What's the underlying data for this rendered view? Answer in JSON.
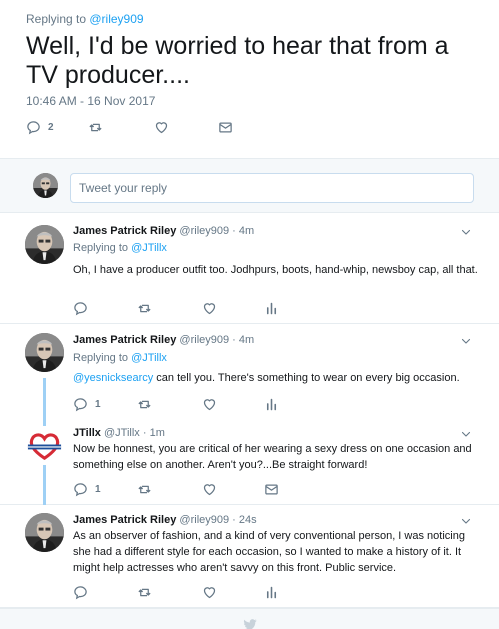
{
  "main_tweet": {
    "replying_prefix": "Replying to ",
    "replying_handle": "@riley909",
    "text": "Well, I'd be worried to hear that from a TV producer....",
    "timestamp": "10:46 AM - 16 Nov 2017",
    "reply_count": "2"
  },
  "reply_box": {
    "placeholder": "Tweet your reply"
  },
  "tweets": [
    {
      "name": "James Patrick Riley",
      "handle": "@riley909",
      "sep": " · ",
      "time": "4m",
      "replying_prefix": "Replying to ",
      "replying_handle": "@JTillx",
      "text": "Oh, I have a producer outfit too.  Jodhpurs, boots, hand-whip, newsboy cap, all that."
    },
    {
      "name": "James Patrick Riley",
      "handle": "@riley909",
      "sep": " · ",
      "time": "4m",
      "replying_prefix": "Replying to ",
      "replying_handle": "@JTillx",
      "mention": "@yesnicksearcy",
      "text": " can tell you.  There's something to wear on every big occasion.",
      "reply_count": "1"
    },
    {
      "name": "JTillx",
      "handle": "@JTillx",
      "sep": " · ",
      "time": "1m",
      "text": "Now be honnest, you are critical of her wearing a sexy dress on one occasion and something else on another. Aren't you?...Be straight forward!",
      "reply_count": "1"
    },
    {
      "name": "James Patrick Riley",
      "handle": "@riley909",
      "sep": " · ",
      "time": "24s",
      "text": "As an observer of fashion, and a kind of very conventional person, I was noticing she had a different style for each occasion, so I wanted to make a history of it. It might help actresses who aren't savvy on this front. Public service."
    }
  ],
  "icons": {
    "reply": "reply-icon",
    "retweet": "retweet-icon",
    "like": "heart-icon",
    "dm": "direct-message-icon",
    "analytics": "analytics-icon",
    "caret": "chevron-down-icon"
  },
  "colors": {
    "link": "#1da1f2",
    "muted": "#657786",
    "thread_line": "#9ed0f5"
  }
}
